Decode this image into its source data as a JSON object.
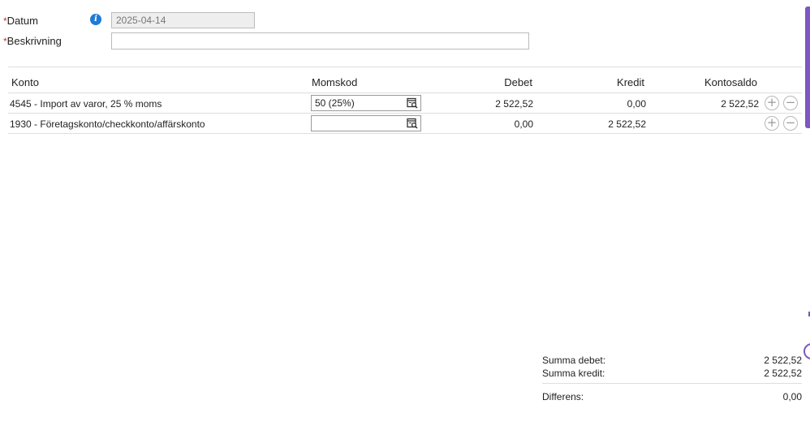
{
  "form": {
    "required_mark": "*",
    "date_label": "Datum",
    "date_value": "2025-04-14",
    "info_icon": "info-icon",
    "description_label": "Beskrivning",
    "description_value": ""
  },
  "table": {
    "headers": {
      "konto": "Konto",
      "momskod": "Momskod",
      "debet": "Debet",
      "kredit": "Kredit",
      "kontosaldo": "Kontosaldo"
    },
    "rows": [
      {
        "konto": "4545 - Import av varor, 25 % moms",
        "momskod": "50 (25%)",
        "debet": "2 522,52",
        "kredit": "0,00",
        "kontosaldo": "2 522,52"
      },
      {
        "konto": "1930 - Företagskonto/checkkonto/affärskonto",
        "momskod": "",
        "debet": "0,00",
        "kredit": "2 522,52",
        "kontosaldo": ""
      }
    ],
    "add_symbol": "+",
    "remove_symbol": "−"
  },
  "summary": {
    "debet_label": "Summa debet:",
    "debet_value": "2 522,52",
    "kredit_label": "Summa kredit:",
    "kredit_value": "2 522,52",
    "diff_label": "Differens:",
    "diff_value": "0,00"
  },
  "colors": {
    "info": "#1e7bd6",
    "required": "#c0392b",
    "accent": "#7e57c2"
  }
}
